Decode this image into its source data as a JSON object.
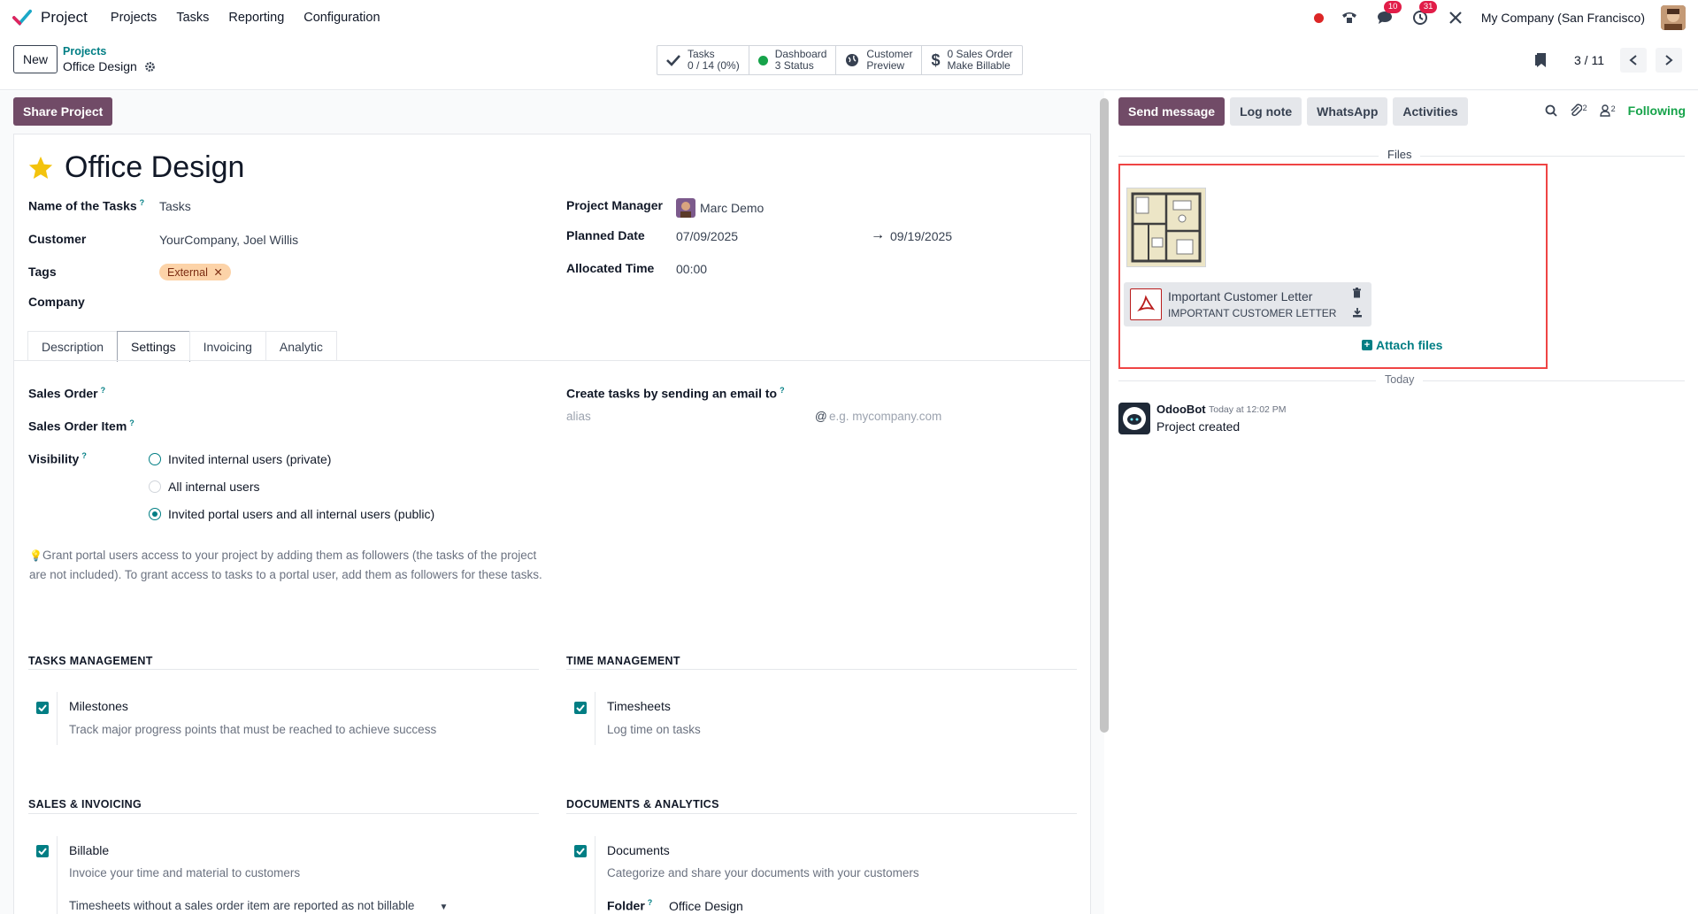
{
  "navbar": {
    "app_name": "Project",
    "menu": [
      "Projects",
      "Tasks",
      "Reporting",
      "Configuration"
    ],
    "chat_badge": "10",
    "activity_badge": "31",
    "company": "My Company (San Francisco)"
  },
  "control": {
    "new_label": "New",
    "breadcrumb_parent": "Projects",
    "breadcrumb_current": "Office Design",
    "smart_buttons": [
      {
        "line1": "Tasks",
        "line2": "0 / 14 (0%)"
      },
      {
        "line1": "Dashboard",
        "line2": "3 Status"
      },
      {
        "line1": "Customer",
        "line2": "Preview"
      },
      {
        "line1": "0 Sales Order",
        "line2": "Make Billable"
      }
    ],
    "pager": "3 / 11"
  },
  "form": {
    "share_label": "Share Project",
    "title": "Office Design",
    "fields": {
      "name_tasks_label": "Name of the Tasks",
      "name_tasks_value": "Tasks",
      "customer_label": "Customer",
      "customer_value": "YourCompany, Joel Willis",
      "tags_label": "Tags",
      "tag_value": "External",
      "company_label": "Company",
      "manager_label": "Project Manager",
      "manager_value": "Marc Demo",
      "planned_label": "Planned Date",
      "planned_start": "07/09/2025",
      "planned_end": "09/19/2025",
      "allocated_label": "Allocated Time",
      "allocated_value": "00:00"
    },
    "tabs": [
      "Description",
      "Settings",
      "Invoicing",
      "Analytic"
    ],
    "settings": {
      "sales_order_label": "Sales Order",
      "sales_order_item_label": "Sales Order Item",
      "visibility_label": "Visibility",
      "visibility_options": [
        "Invited internal users (private)",
        "All internal users",
        "Invited portal users and all internal users (public)"
      ],
      "help_text": "Grant portal users access to your project by adding them as followers (the tasks of the project are not included). To grant access to tasks to a portal user, add them as followers for these tasks.",
      "email_label": "Create tasks by sending an email to",
      "alias_placeholder": "alias",
      "domain_placeholder": "e.g. mycompany.com",
      "tasks_mgmt_title": "TASKS MANAGEMENT",
      "milestones_title": "Milestones",
      "milestones_desc": "Track major progress points that must be reached to achieve success",
      "time_mgmt_title": "TIME MANAGEMENT",
      "timesheets_title": "Timesheets",
      "timesheets_desc": "Log time on tasks",
      "sales_title": "SALES & INVOICING",
      "billable_title": "Billable",
      "billable_desc": "Invoice your time and material to customers",
      "billable_select": "Timesheets without a sales order item are reported as not billable",
      "docs_title": "DOCUMENTS & ANALYTICS",
      "documents_title": "Documents",
      "documents_desc": "Categorize and share your documents with your customers",
      "folder_label": "Folder",
      "folder_value": "Office Design"
    }
  },
  "chatter": {
    "send_message": "Send message",
    "log_note": "Log note",
    "whatsapp": "WhatsApp",
    "activities": "Activities",
    "attachments_count": "2",
    "followers_count": "2",
    "following": "Following",
    "files_label": "Files",
    "file_name": "Important Customer Letter",
    "file_sub": "IMPORTANT CUSTOMER LETTER",
    "attach_files": "Attach files",
    "today_label": "Today",
    "author": "OdooBot",
    "time": "Today at 12:02 PM",
    "message": "Project created"
  },
  "colors": {
    "brand": "#714b67",
    "accent": "#017e84",
    "highlight_box": "#ef4444"
  }
}
